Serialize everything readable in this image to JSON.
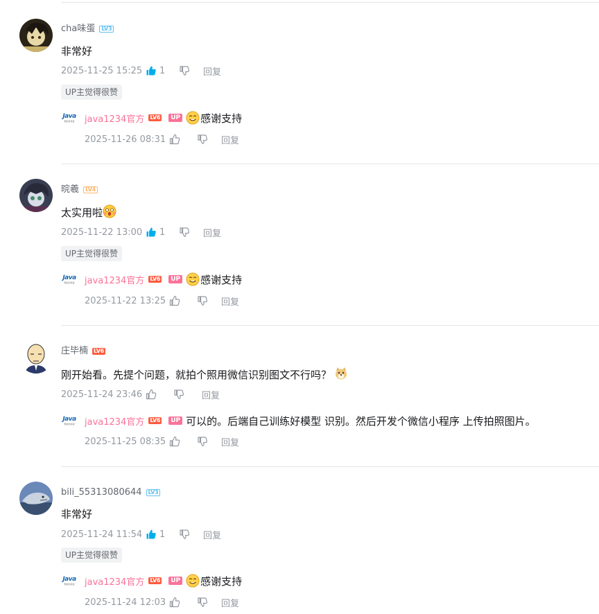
{
  "comments": [
    {
      "username": "cha味蛋",
      "level": "LV3",
      "text": "非常好",
      "time": "2025-11-25 15:25",
      "likes": "1",
      "liked": true,
      "reply_label": "回复",
      "up_tag": "UP主觉得很赞",
      "reply": {
        "name": "java1234官方",
        "level": "LV6",
        "up_badge": "UP",
        "emoji": "smile-emoji",
        "text": "感谢支持",
        "time": "2025-11-26 08:31",
        "reply_label": "回复"
      }
    },
    {
      "username": "晥羲",
      "level": "LV4",
      "text": "太实用啦",
      "time": "2025-11-22 13:00",
      "likes": "1",
      "liked": true,
      "reply_label": "回复",
      "up_tag": "UP主觉得很赞",
      "reply": {
        "name": "java1234官方",
        "level": "LV6",
        "up_badge": "UP",
        "emoji": "smile-emoji",
        "text": "感谢支持",
        "time": "2025-11-22 13:25",
        "reply_label": "回复"
      }
    },
    {
      "username": "庄毕楠",
      "level": "LV6",
      "text": "刚开始看。先提个问题，就拍个照用微信识别图文不行吗？",
      "time": "2025-11-24 23:46",
      "likes": "",
      "liked": false,
      "reply_label": "回复",
      "up_tag": "",
      "reply": {
        "name": "java1234官方",
        "level": "LV6",
        "up_badge": "UP",
        "emoji": "",
        "text": "可以的。后端自己训练好模型 识别。然后开发个微信小程序 上传拍照图片。",
        "time": "2025-11-25 08:35",
        "reply_label": "回复"
      }
    },
    {
      "username": "bili_55313080644",
      "level": "LV3",
      "text": "非常好",
      "time": "2025-11-24 11:54",
      "likes": "1",
      "liked": true,
      "reply_label": "回复",
      "up_tag": "UP主觉得很赞",
      "reply": {
        "name": "java1234官方",
        "level": "LV6",
        "up_badge": "UP",
        "emoji": "smile-emoji",
        "text": "感谢支持",
        "time": "2025-11-24 12:03",
        "reply_label": "回复"
      }
    }
  ],
  "sub_avatar": {
    "logo_text": "Java",
    "sub_text": "知识分享社"
  },
  "colors": {
    "accent_blue": "#00aeec",
    "pink": "#fb7299",
    "gray": "#9499a0",
    "level6": "#ff5b3f",
    "level3": "#61c0f0",
    "level4": "#feb76c"
  }
}
